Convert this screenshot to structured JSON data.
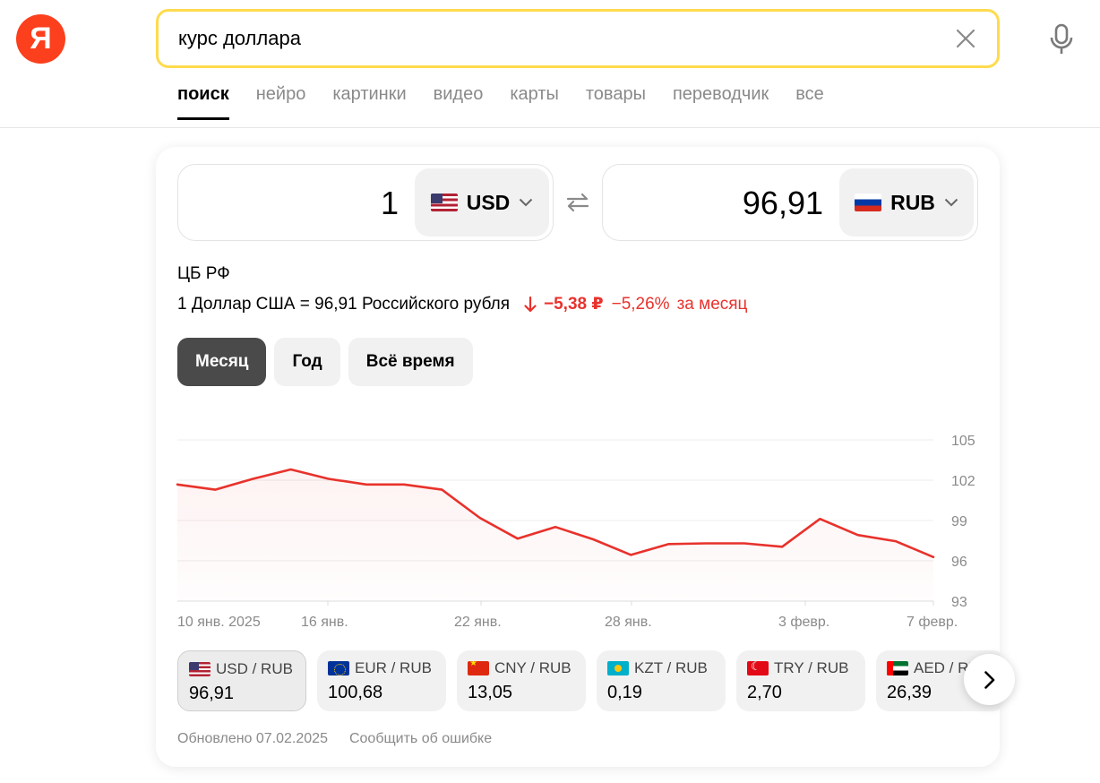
{
  "logo": {
    "text": "Я"
  },
  "search": {
    "query": "курс доллара"
  },
  "icons": {
    "clear": "close-icon",
    "mic": "microphone-icon",
    "swap": "swap-arrows-icon",
    "chevron": "chevron-down-icon",
    "next": "chevron-right-icon",
    "down_arrow": "arrow-down-icon"
  },
  "tabs": [
    {
      "label": "поиск",
      "active": true
    },
    {
      "label": "нейро"
    },
    {
      "label": "картинки"
    },
    {
      "label": "видео"
    },
    {
      "label": "карты"
    },
    {
      "label": "товары"
    },
    {
      "label": "переводчик"
    },
    {
      "label": "все"
    }
  ],
  "converter": {
    "from": {
      "amount": "1",
      "currency": "USD",
      "flag": "us-flag"
    },
    "to": {
      "amount": "96,91",
      "currency": "RUB",
      "flag": "ru-flag"
    }
  },
  "rate": {
    "source": "ЦБ РФ",
    "text": "1 Доллар США = 96,91 Российского рубля",
    "change_abs": "−5,38 ₽",
    "change_pct": "−5,26%",
    "change_period": "за месяц",
    "change_color": "#e8322c"
  },
  "period_buttons": [
    {
      "label": "Месяц",
      "active": true
    },
    {
      "label": "Год"
    },
    {
      "label": "Всё время"
    }
  ],
  "chart_data": {
    "type": "line",
    "line_color": "#e8322c",
    "x_tick_labels": [
      "10 янв. 2025",
      "16 янв.",
      "22 янв.",
      "28 янв.",
      "3 февр.",
      "7 февр."
    ],
    "y_tick_labels": [
      "105",
      "102",
      "99",
      "96",
      "93"
    ],
    "ylim": [
      93,
      105
    ],
    "grid": true,
    "values": [
      101.68,
      101.29,
      102.1,
      102.8,
      102.1,
      101.68,
      101.68,
      101.29,
      99.2,
      97.65,
      98.52,
      97.6,
      96.44,
      97.25,
      97.3,
      97.3,
      97.05,
      99.12,
      97.92,
      97.46,
      96.28
    ]
  },
  "pairs": [
    {
      "label": "USD / RUB",
      "value": "96,91",
      "flag": "us-flag",
      "active": true
    },
    {
      "label": "EUR / RUB",
      "value": "100,68",
      "flag": "eu-flag"
    },
    {
      "label": "CNY / RUB",
      "value": "13,05",
      "flag": "cn-flag"
    },
    {
      "label": "KZT / RUB",
      "value": "0,19",
      "flag": "kz-flag"
    },
    {
      "label": "TRY / RUB",
      "value": "2,70",
      "flag": "tr-flag"
    },
    {
      "label": "AED / RUB",
      "value": "26,39",
      "flag": "ae-flag"
    }
  ],
  "footer": {
    "updated": "Обновлено 07.02.2025",
    "report": "Сообщить об ошибке"
  }
}
